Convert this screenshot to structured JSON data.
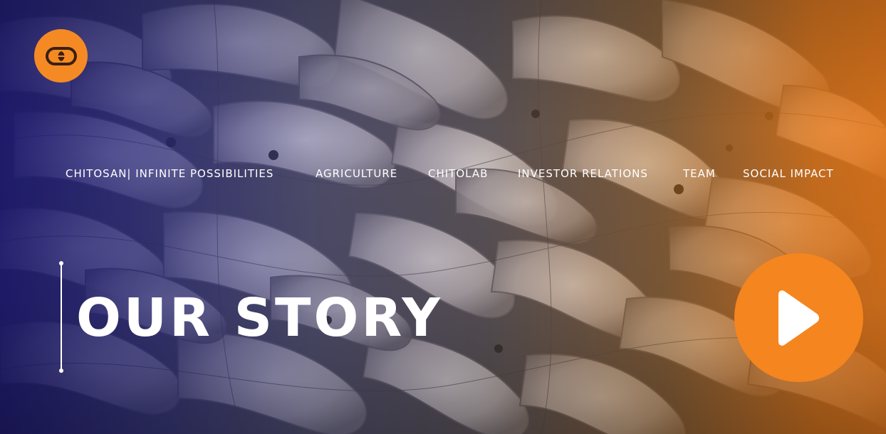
{
  "colors": {
    "accent": "#f5851f",
    "overlay_left": "#1c186e",
    "overlay_right": "#eb7814",
    "text": "#ffffff"
  },
  "logo": {
    "icon": "chain-link-icon"
  },
  "nav": {
    "items": [
      {
        "label": "CHITOSAN| INFINITE POSSIBILITIES"
      },
      {
        "label": "AGRICULTURE"
      },
      {
        "label": "CHITOLAB"
      },
      {
        "label": "INVESTOR RELATIONS"
      },
      {
        "label": "TEAM"
      },
      {
        "label": "SOCIAL IMPACT"
      }
    ]
  },
  "hero": {
    "background": "shrimp-photo",
    "title": "OUR STORY",
    "play_icon": "play-icon"
  }
}
